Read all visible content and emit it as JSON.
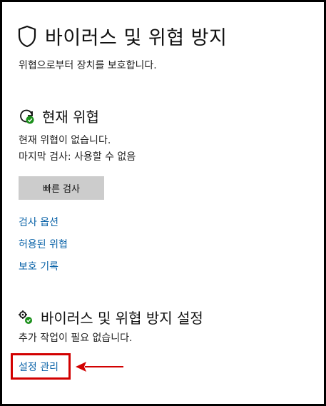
{
  "header": {
    "title": "바이러스 및 위협 방지",
    "subtitle": "위협으로부터 장치를 보호합니다.",
    "icon": "shield-icon"
  },
  "current_threats": {
    "title": "현재 위협",
    "icon": "threat-refresh-icon",
    "status_line": "현재 위협이 없습니다.",
    "last_scan_line": "마지막 검사: 사용할 수 없음",
    "quick_scan_label": "빠른 검사",
    "links": [
      "검사 옵션",
      "허용된 위협",
      "보호 기록"
    ]
  },
  "settings": {
    "title": "바이러스 및 위협 방지 설정",
    "icon": "settings-gears-icon",
    "status_line": "추가 작업이 필요 없습니다.",
    "manage_link": "설정 관리"
  },
  "colors": {
    "link": "#0a63a8",
    "button_bg": "#cccccc",
    "annotation_red": "#d20000",
    "status_green": "#1a8f1a"
  }
}
